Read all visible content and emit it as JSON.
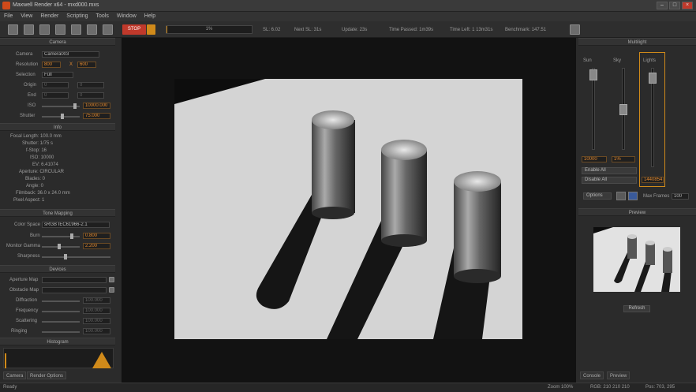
{
  "window": {
    "title": "Maxwell Render    x64 - mxd000.mxs"
  },
  "menu": [
    "File",
    "View",
    "Render",
    "Scripting",
    "Tools",
    "Window",
    "Help"
  ],
  "toolbar": {
    "stop_label": "STOP",
    "progress_label": "1%",
    "progress_value": 0.01,
    "stats": {
      "sl": "SL: 6.02",
      "next_sl": "Next SL: 31s",
      "update": "Update: 23s",
      "time_passed": "Time Passed: 1m39s",
      "time_left": "Time Left: 1 13m31s",
      "benchmark": "Benchmark: 147.51"
    }
  },
  "left_panel": {
    "camera_section": "Camera",
    "camera_label": "Camera",
    "camera_value": "Camera003",
    "resolution_label": "Resolution",
    "res_w": "800",
    "res_x": "X",
    "res_h": "600",
    "selection_label": "Selection",
    "selection_value": "Full",
    "origin_label": "Origin",
    "origin_x": "0",
    "origin_y": "0",
    "end_label": "End",
    "end_x": "0",
    "end_y": "0",
    "iso_label": "ISO",
    "iso_value": "10000.000",
    "shutter_label": "Shutter",
    "shutter_value": "75.000",
    "info_section": "Info",
    "info_lines": [
      "Focal Length: 100.0 mm",
      "Shutter: 1/75 s",
      "f-Stop: 16",
      "ISO: 10000",
      "EV: 6.41074",
      "Aperture: CIRCULAR",
      "Blades: 0",
      "Angle: 0",
      "Filmback: 36.0 x 24.0 mm",
      "Pixel Aspect: 1"
    ],
    "tone_section": "Tone Mapping",
    "color_space_label": "Color Space",
    "color_space_value": "sRGB IEC61966-2.1",
    "burn_label": "Burn",
    "burn_value": "0.800",
    "monitor_gamma_label": "Monitor Gamma",
    "monitor_gamma_value": "2.200",
    "sharpness_label": "Sharpness",
    "devices_section": "Devices",
    "aperture_map_label": "Aperture Map",
    "obstacle_map_label": "Obstacle Map",
    "diffraction_label": "Diffraction",
    "diffraction_value": "100.000",
    "frequency_label": "Frequency",
    "frequency_value": "100.000",
    "scattering_label": "Scattering",
    "scattering_value": "100.000",
    "ringing_label": "Ringing",
    "ringing_value": "100.000",
    "histogram_section": "Histogram",
    "tabs": [
      "Camera",
      "Render Options"
    ]
  },
  "right_panel": {
    "multilight_section": "Multilight",
    "channels": [
      "Sun",
      "Sky",
      "Lights"
    ],
    "ch1_value": "10000",
    "ch2_value": "1%",
    "ch3_value": "1440854",
    "enable_all": "Enable All",
    "disable_all": "Disable All",
    "options_label": "Options",
    "max_frames_label": "Max Frames",
    "max_frames_value": "100",
    "preview_section": "Preview",
    "refresh_label": "Refresh",
    "tabs": [
      "Console",
      "Preview"
    ]
  },
  "status": {
    "ready": "Ready",
    "zoom": "Zoom 100%",
    "rgb": "RGB: 210 210 210",
    "pos": "Pos: 703, 295"
  },
  "colors": {
    "accent_orange": "#e58a30",
    "stop_red": "#c0392b",
    "bg": "#2b2b2b"
  }
}
